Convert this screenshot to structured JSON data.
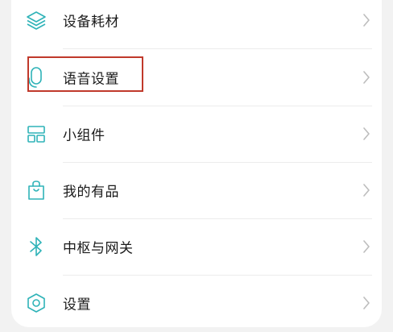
{
  "menu": {
    "items": [
      {
        "label": "设备耗材",
        "icon": "layers-icon"
      },
      {
        "label": "语音设置",
        "icon": "microphone-icon"
      },
      {
        "label": "小组件",
        "icon": "widgets-icon"
      },
      {
        "label": "我的有品",
        "icon": "shopping-bag-icon"
      },
      {
        "label": "中枢与网关",
        "icon": "bluetooth-icon"
      },
      {
        "label": "设置",
        "icon": "settings-hexagon-icon"
      }
    ]
  },
  "colors": {
    "icon_accent": "#2fb3b8",
    "chevron": "#bdbdbd",
    "highlight_border": "#c0392b",
    "text": "#1a1a1a"
  },
  "highlighted_item": "语音设置"
}
